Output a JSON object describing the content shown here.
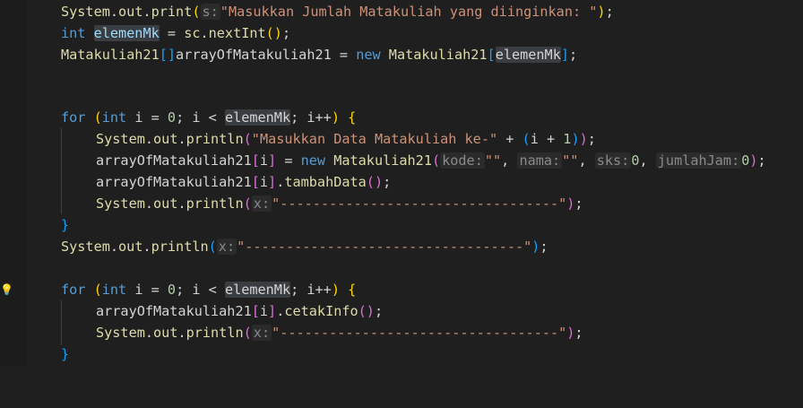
{
  "editor": {
    "line1": {
      "a": "System",
      "b": ".",
      "c": "out",
      "d": ".",
      "e": "print",
      "f": "(",
      "hint": "s:",
      "str": "\"Masukkan Jumlah Matakuliah yang diinginkan: \"",
      "g": ")",
      "h": ";"
    },
    "line2": {
      "kw": "int",
      "var": "elemenMk",
      "rest1": " = ",
      "obj": "sc",
      "dot": ".",
      "fn": "nextInt",
      "paren": "()",
      "semi": ";"
    },
    "line3": {
      "type": "Matakuliah21",
      "br1": "[]",
      "name": "arrayOfMatakuliah21",
      "eq": " = ",
      "kw": "new",
      "sp": " ",
      "type2": "Matakuliah21",
      "br2": "[",
      "var": "elemenMk",
      "br3": "]",
      "semi": ";"
    },
    "for1": {
      "kw": "for",
      "sp": " ",
      "p1": "(",
      "kw2": "int",
      "rest": " i = ",
      "zero": "0",
      "rest2": "; i < ",
      "var": "elemenMk",
      "rest3": "; i++",
      "p2": ")",
      "brace": " {"
    },
    "body1a": {
      "a": "System",
      "b": ".",
      "c": "out",
      "d": ".",
      "e": "println",
      "f": "(",
      "str": "\"Masukkan Data Matakuliah ke-\"",
      "mid": " + ",
      "p1": "(",
      "mid2": "i + ",
      "one": "1",
      "p2": ")",
      "g": ")",
      "h": ";"
    },
    "body1b": {
      "a": "arrayOfMatakuliah21",
      "br1": "[",
      "i": "i",
      "br2": "]",
      "eq": " = ",
      "kw": "new",
      "sp": " ",
      "type": "Matakuliah21",
      "p1": "(",
      "h1": "kode:",
      "s1": "\"\"",
      "c1": ", ",
      "h2": "nama:",
      "s2": "\"\"",
      "c2": ", ",
      "h3": "sks:",
      "n1": "0",
      "c3": ", ",
      "h4": "jumlahJam:",
      "n2": "0",
      "p2": ")",
      "semi": ";"
    },
    "body1c": {
      "a": "arrayOfMatakuliah21",
      "br1": "[",
      "i": "i",
      "br2": "]",
      "dot": ".",
      "fn": "tambahData",
      "paren": "()",
      "semi": ";"
    },
    "body1d": {
      "a": "System",
      "b": ".",
      "c": "out",
      "d": ".",
      "e": "println",
      "f": "(",
      "hint": "x:",
      "str": "\"----------------------------------\"",
      "g": ")",
      "h": ";"
    },
    "close1": "}",
    "after1": {
      "a": "System",
      "b": ".",
      "c": "out",
      "d": ".",
      "e": "println",
      "f": "(",
      "hint": "x:",
      "str": "\"----------------------------------\"",
      "g": ")",
      "h": ";"
    },
    "for2": {
      "kw": "for",
      "sp": " ",
      "p1": "(",
      "kw2": "int",
      "rest": " i = ",
      "zero": "0",
      "rest2": "; i < ",
      "var": "elemenMk",
      "rest3": "; i++",
      "p2": ")",
      "brace": " {"
    },
    "body2a": {
      "a": "arrayOfMatakuliah21",
      "br1": "[",
      "i": "i",
      "br2": "]",
      "dot": ".",
      "fn": "cetakInfo",
      "paren": "()",
      "semi": ";"
    },
    "body2b": {
      "a": "System",
      "b": ".",
      "c": "out",
      "d": ".",
      "e": "println",
      "f": "(",
      "hint": "x:",
      "str": "\"----------------------------------\"",
      "g": ")",
      "h": ";"
    },
    "close2": "}",
    "lightbulb_icon": "lightbulb-icon",
    "colors": {
      "background": "#1f1f1f",
      "keyword": "#569cd6",
      "type": "#dcdcaa",
      "string": "#ce9178",
      "number": "#b5cea8",
      "bracket_yellow": "#ffd700",
      "bracket_pink": "#da70d6",
      "bracket_blue": "#179fff"
    }
  }
}
